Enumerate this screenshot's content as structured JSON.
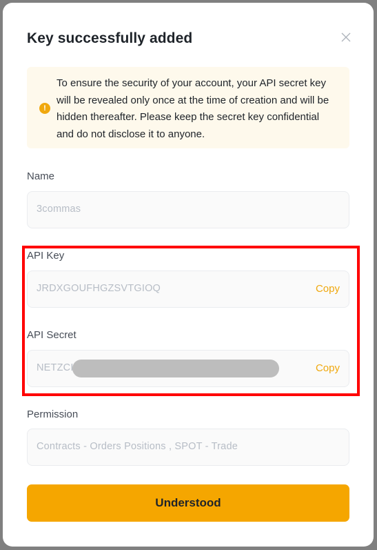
{
  "dialog": {
    "title": "Key successfully added",
    "notice": "To ensure the security of your account, your API secret key will be revealed only once at the time of creation and will be hidden thereafter. Please keep the secret key confidential and do not disclose it to anyone.",
    "notice_icon": "!"
  },
  "fields": {
    "name": {
      "label": "Name",
      "value": "3commas"
    },
    "api_key": {
      "label": "API Key",
      "value": "JRDXGOUFHGZSVTGIOQ",
      "copy": "Copy"
    },
    "api_secret": {
      "label": "API Secret",
      "value": "NETZCI",
      "copy": "Copy"
    },
    "permission": {
      "label": "Permission",
      "value": "Contracts - Orders Positions  , SPOT - Trade"
    }
  },
  "actions": {
    "confirm": "Understood"
  },
  "colors": {
    "accent": "#f0a80e",
    "button": "#f5a600",
    "highlight": "#ff0000",
    "notice_bg": "#fef9ec"
  },
  "icons": {
    "close": "close-icon",
    "notice": "warning-icon"
  }
}
